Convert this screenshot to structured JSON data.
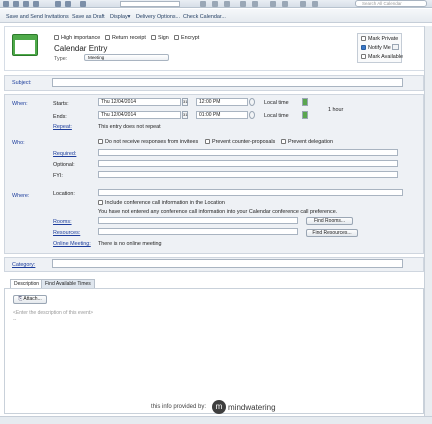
{
  "toolbar": {
    "search_placeholder": "Search All Calendar"
  },
  "menu": {
    "save_send": "Save and Send Invitations",
    "save_draft": "Save as Draft",
    "display": "Display▾",
    "delivery": "Delivery Options...",
    "check_calendar": "Check Calendar..."
  },
  "header": {
    "high_importance": "High importance",
    "return_receipt": "Return receipt",
    "sign": "Sign",
    "encrypt": "Encrypt",
    "title": "Calendar Entry",
    "type_label": "Type:",
    "type_value": "Meeting",
    "mark_private": "Mark Private",
    "notify_me": "Notify Me",
    "mark_available": "Mark Available",
    "notify_me_checked": true
  },
  "subject": {
    "label": "Subject:",
    "value": ""
  },
  "when": {
    "label": "When:",
    "starts_label": "Starts:",
    "starts_date": "Thu 12/04/2014",
    "starts_time": "12:00 PM",
    "starts_zone": "Local time",
    "ends_label": "Ends:",
    "ends_date": "Thu 12/04/2014",
    "ends_time": "01:00 PM",
    "ends_zone": "Local time",
    "duration": "1 hour",
    "repeat_label": "Repeat:",
    "repeat_text": "This entry does not repeat",
    "cal_btn": "31"
  },
  "who": {
    "label": "Who:",
    "no_responses": "Do not receive responses from invitees",
    "prevent_counter": "Prevent counter-proposals",
    "prevent_delegation": "Prevent delegation",
    "required": "Required:",
    "optional": "Optional:",
    "fyi": "FYI:"
  },
  "where": {
    "label": "Where:",
    "location": "Location:",
    "include_conf": "Include conference call information in the Location",
    "conf_note": "You have not entered any conference call information into your Calendar conference call preference.",
    "rooms": "Rooms:",
    "find_rooms": "Find Rooms...",
    "resources": "Resources:",
    "find_resources": "Find Resources...",
    "online_meeting": "Online Meeting:",
    "online_text": "There is no online meeting"
  },
  "category": {
    "label": "Category:"
  },
  "tabs": {
    "description": "Description",
    "find_times": "Find Available Times"
  },
  "description": {
    "attach": "Attach...",
    "placeholder": "<Enter the description of this event>",
    "dash": "--"
  },
  "footer": {
    "info": "this info provided by:",
    "brand": "mindwatering"
  },
  "colors": {
    "accent_blue": "#1c3d9c",
    "calendar_green": "#4faa4a",
    "panel_bg": "#eef1f5"
  }
}
